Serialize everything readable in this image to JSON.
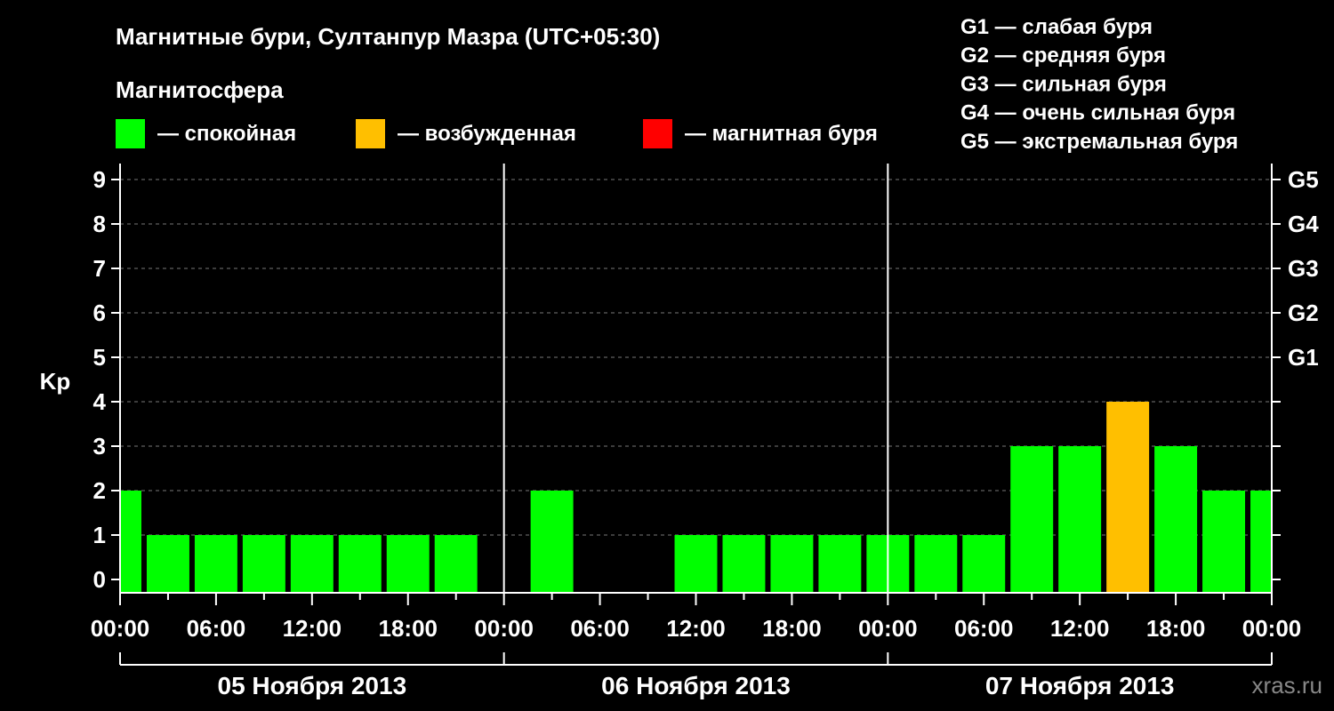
{
  "title": "Магнитные бури, Султанпур Мазра (UTC+05:30)",
  "legend": {
    "heading": "Магнитосфера",
    "items": [
      {
        "color": "#00ff00",
        "label": "— спокойная"
      },
      {
        "color": "#ffbf00",
        "label": "— возбужденная"
      },
      {
        "color": "#ff0000",
        "label": "— магнитная буря"
      }
    ]
  },
  "g_scale": [
    "G1 — слабая буря",
    "G2 — средняя буря",
    "G3 — сильная буря",
    "G4 — очень сильная буря",
    "G5 — экстремальная буря"
  ],
  "watermark": "xras.ru",
  "chart_data": {
    "type": "bar",
    "ylabel": "Kp",
    "ylim": [
      0,
      9
    ],
    "y_ticks": [
      0,
      1,
      2,
      3,
      4,
      5,
      6,
      7,
      8,
      9
    ],
    "right_ticks": [
      {
        "kp": 5,
        "label": "G1"
      },
      {
        "kp": 6,
        "label": "G2"
      },
      {
        "kp": 7,
        "label": "G3"
      },
      {
        "kp": 8,
        "label": "G4"
      },
      {
        "kp": 9,
        "label": "G5"
      }
    ],
    "x_tick_labels": [
      "00:00",
      "06:00",
      "12:00",
      "18:00",
      "00:00",
      "06:00",
      "12:00",
      "18:00",
      "00:00",
      "06:00",
      "12:00",
      "18:00",
      "00:00"
    ],
    "x_tick_hours": [
      0,
      6,
      12,
      18,
      24,
      30,
      36,
      42,
      48,
      54,
      60,
      66,
      72
    ],
    "days": [
      {
        "label": "05 Ноября 2013",
        "start": 0,
        "end": 24
      },
      {
        "label": "06 Ноября 2013",
        "start": 24,
        "end": 48
      },
      {
        "label": "07 Ноября 2013",
        "start": 48,
        "end": 72
      }
    ],
    "grid": "dashed horizontal",
    "series": [
      {
        "interval_hours": 3,
        "start_hour": -1.5,
        "values": [
          2,
          1,
          1,
          1,
          1,
          1,
          1,
          1,
          null,
          2,
          0,
          0,
          1,
          1,
          1,
          1,
          1,
          1,
          1,
          3,
          3,
          4,
          3,
          2,
          2
        ],
        "states": [
          "quiet",
          "quiet",
          "quiet",
          "quiet",
          "quiet",
          "quiet",
          "quiet",
          "quiet",
          null,
          "quiet",
          null,
          null,
          "quiet",
          "quiet",
          "quiet",
          "quiet",
          "quiet",
          "quiet",
          "quiet",
          "quiet",
          "quiet",
          "active",
          "quiet",
          "quiet",
          "quiet"
        ]
      }
    ],
    "state_colors": {
      "quiet": "#00ff00",
      "active": "#ffbf00",
      "storm": "#ff0000"
    }
  }
}
